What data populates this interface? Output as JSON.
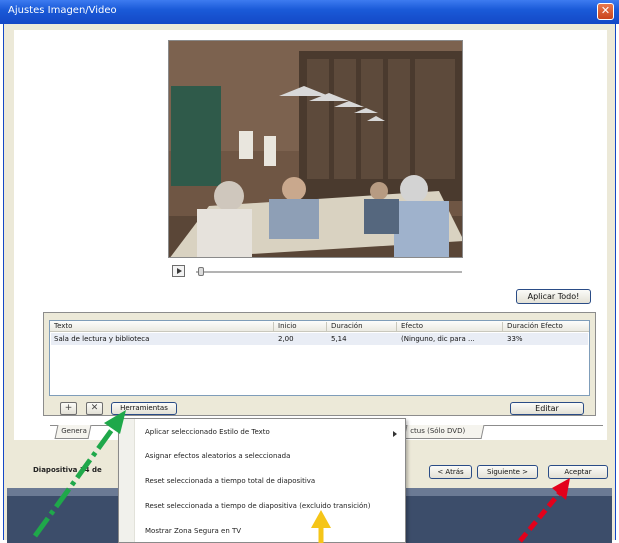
{
  "window": {
    "title": "Ajustes Imagen/Video",
    "close_glyph": "✕"
  },
  "toolbar": {
    "apply_all_label": "Aplicar Todo!"
  },
  "table": {
    "columns": [
      "Texto",
      "Inicio",
      "Duración",
      "Efecto",
      "Duración Efecto"
    ],
    "rows": [
      [
        "Sala de lectura y biblioteca",
        "2,00",
        "5,14",
        "(Ninguno, dic para ...",
        "33%"
      ]
    ]
  },
  "table_buttons": {
    "add_glyph": "+",
    "remove_glyph": "✕",
    "tools_label": "Herramientas",
    "edit_label": "Editar"
  },
  "tabs": [
    {
      "label": "Genera"
    },
    {
      "label": "ctus (Sólo DVD)"
    }
  ],
  "status": {
    "slide_label": "Diapositiva 14 de"
  },
  "nav": {
    "back_label": "< Atrás",
    "next_label": "Siguiente >",
    "accept_label": "Aceptar"
  },
  "menu": {
    "items": [
      "Aplicar seleccionado Estilo de Texto",
      "Asignar efectos aleatorios a seleccionada",
      "Reset seleccionada a tiempo total de diapositiva",
      "Reset seleccionada a tiempo de diapositiva (excluido transición)",
      "Mostrar Zona Segura en TV"
    ]
  },
  "colors": {
    "title_bar": "#1a5ad8",
    "arrow_green": "#1fa84a",
    "arrow_yellow": "#f5c518",
    "arrow_red": "#e3001b"
  }
}
